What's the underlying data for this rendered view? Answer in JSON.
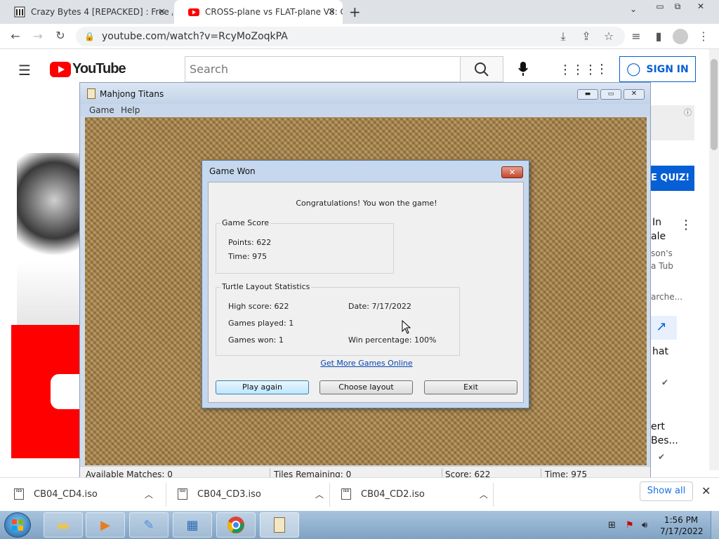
{
  "browser": {
    "tabs": [
      {
        "title": "Crazy Bytes 4 [REPACKED] : Free /"
      },
      {
        "title": "CROSS-plane vs FLAT-plane V8: C"
      }
    ],
    "url": "youtube.com/watch?v=RcyMoZoqkPA"
  },
  "youtube": {
    "logo_text": "YouTube",
    "search_placeholder": "Search",
    "signin_label": "SIGN IN",
    "side_texts": [
      "E QUIZ!",
      "In",
      "ale",
      "son's",
      "a Tub",
      "arche...",
      "hat",
      "ert",
      "Bes..."
    ]
  },
  "game": {
    "window_title": "Mahjong Titans",
    "menu": [
      "Game",
      "Help"
    ],
    "status": {
      "available": "Available Matches: 0",
      "tiles": "Tiles Remaining: 0",
      "score": "Score: 622",
      "time": "Time: 975"
    }
  },
  "dialog": {
    "title": "Game Won",
    "message": "Congratulations! You won the game!",
    "score_group": "Game Score",
    "points": "Points: 622",
    "time": "Time: 975",
    "stats_group": "Turtle Layout Statistics",
    "high_score": "High score: 622",
    "date": "Date: 7/17/2022",
    "games_played": "Games played: 1",
    "games_won": "Games won: 1",
    "win_pct": "Win percentage: 100%",
    "link": "Get More Games Online",
    "buttons": {
      "play": "Play again",
      "layout": "Choose layout",
      "exit": "Exit"
    }
  },
  "downloads": {
    "items": [
      "CB04_CD4.iso",
      "CB04_CD3.iso",
      "CB04_CD2.iso"
    ],
    "show_all": "Show all"
  },
  "taskbar": {
    "time": "1:56 PM",
    "date": "7/17/2022"
  },
  "colors": {
    "youtube_red": "#ff0000",
    "signin_blue": "#065fd4",
    "felt": "#b08a4d"
  }
}
